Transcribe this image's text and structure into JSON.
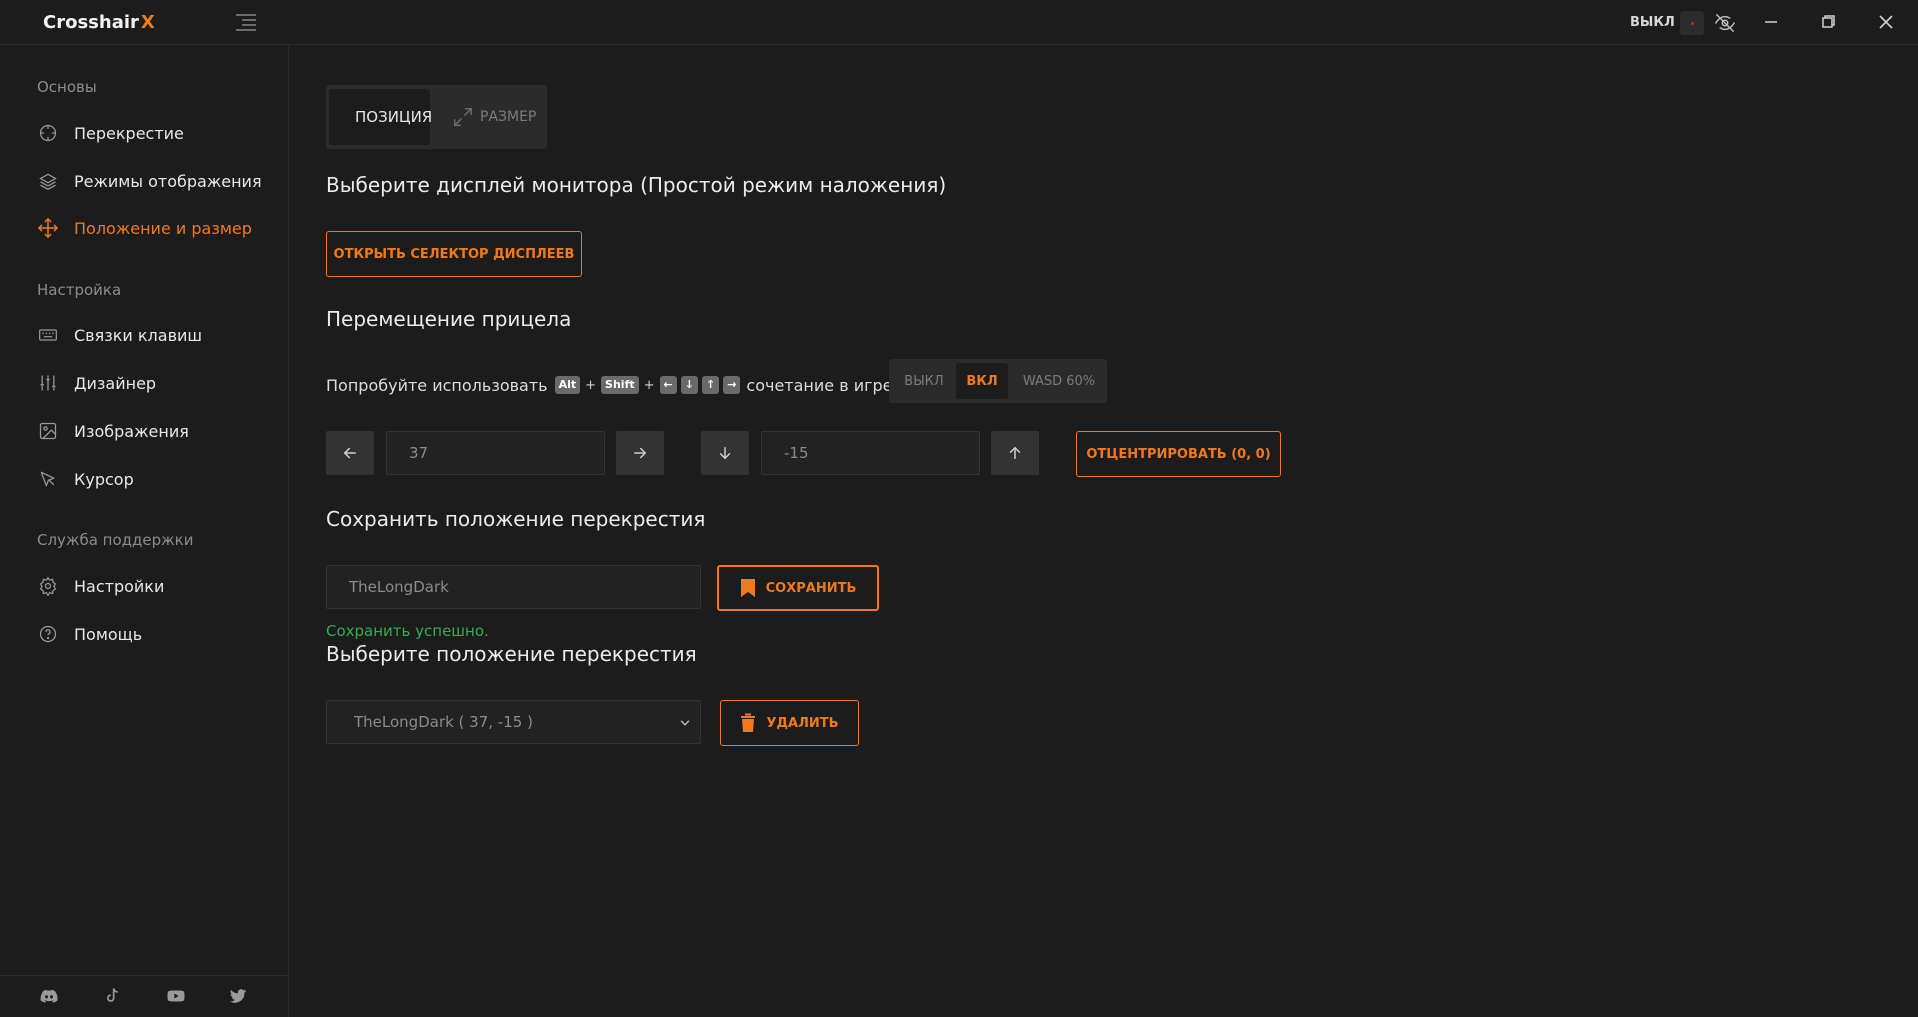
{
  "app": {
    "title": "Crosshair",
    "title_accent": "X"
  },
  "titlebar": {
    "status": "ВЫКЛ"
  },
  "sidebar": {
    "section_basics": "Основы",
    "items_basics": [
      {
        "label": "Перекрестие",
        "icon": "crosshair-icon"
      },
      {
        "label": "Режимы отображения",
        "icon": "layers-icon"
      },
      {
        "label": "Положение и размер",
        "icon": "move-icon",
        "active": true
      }
    ],
    "section_setup": "Настройка",
    "items_setup": [
      {
        "label": "Связки клавиш",
        "icon": "keyboard-icon"
      },
      {
        "label": "Дизайнер",
        "icon": "sliders-icon"
      },
      {
        "label": "Изображения",
        "icon": "image-icon"
      },
      {
        "label": "Курсор",
        "icon": "cursor-icon"
      }
    ],
    "section_support": "Служба поддержки",
    "items_support": [
      {
        "label": "Настройки",
        "icon": "gear-icon"
      },
      {
        "label": "Помощь",
        "icon": "help-icon"
      }
    ],
    "footer_icons": [
      "discord-icon",
      "tiktok-icon",
      "youtube-icon",
      "twitter-icon"
    ]
  },
  "tabs": {
    "position": "ПОЗИЦИЯ",
    "size": "РАЗМЕР"
  },
  "display": {
    "heading": "Выберите дисплей монитора (Простой режим наложения)",
    "open_button": "ОТКРЫТЬ СЕЛЕКТОР ДИСПЛЕЕВ"
  },
  "move": {
    "heading": "Перемещение прицела",
    "hint_prefix": "Попробуйте использовать",
    "keys": [
      "Alt",
      "Shift",
      "←",
      "↓",
      "↑",
      "→"
    ],
    "hint_suffix": "сочетание в игре",
    "mode_options": [
      "ВЫКЛ",
      "ВКЛ",
      "WASD 60%"
    ],
    "mode_selected": "ВКЛ",
    "x_value": "37",
    "y_value": "-15",
    "center_button": "ОТЦЕНТРИРОВАТЬ (0, 0)"
  },
  "save": {
    "heading": "Сохранить положение перекрестия",
    "name_value": "TheLongDark",
    "save_button": "СОХРАНИТЬ",
    "success": "Сохранить успешно."
  },
  "select": {
    "heading": "Выберите положение перекрестия",
    "selected": "TheLongDark ( 37, -15 )",
    "delete_button": "УДАЛИТЬ"
  },
  "colors": {
    "accent": "#f07a1b",
    "background": "#1c1c1c",
    "success": "#2fb14b",
    "panel": "#2b2b2b"
  }
}
